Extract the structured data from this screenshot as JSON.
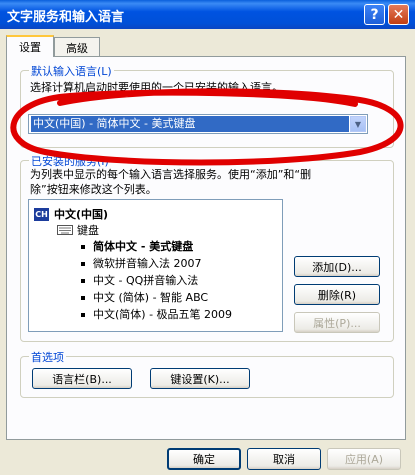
{
  "window": {
    "title": "文字服务和输入语言"
  },
  "tabs": [
    {
      "label": "设置"
    },
    {
      "label": "高级"
    }
  ],
  "default_language": {
    "group_label": "默认输入语言(L)",
    "description": "选择计算机启动时要使用的一个已安装的输入语言。",
    "selected_value": "中文(中国) - 简体中文 - 美式键盘"
  },
  "installed_services": {
    "group_label": "已安装的服务(I)",
    "description_line1": "为列表中显示的每个输入语言选择服务。使用“添加”和“删",
    "description_line2": "除”按钮来修改这个列表。",
    "language": "中文(中国)",
    "language_icon": "CH",
    "category": "键盘",
    "items": [
      {
        "label": "简体中文 - 美式键盘"
      },
      {
        "label": "微软拼音输入法 2007"
      },
      {
        "label": "中文 - QQ拼音输入法"
      },
      {
        "label": "中文 (简体) - 智能 ABC"
      },
      {
        "label": "中文(简体) - 极品五笔 2009"
      }
    ],
    "add_label": "添加(D)...",
    "remove_label": "删除(R)",
    "properties_label": "属性(P)..."
  },
  "preferences": {
    "group_label": "首选项",
    "language_bar_label": "语言栏(B)...",
    "key_settings_label": "键设置(K)..."
  },
  "footer": {
    "ok_label": "确定",
    "cancel_label": "取消",
    "apply_label": "应用(A)"
  },
  "annotation_color": "#E00000"
}
